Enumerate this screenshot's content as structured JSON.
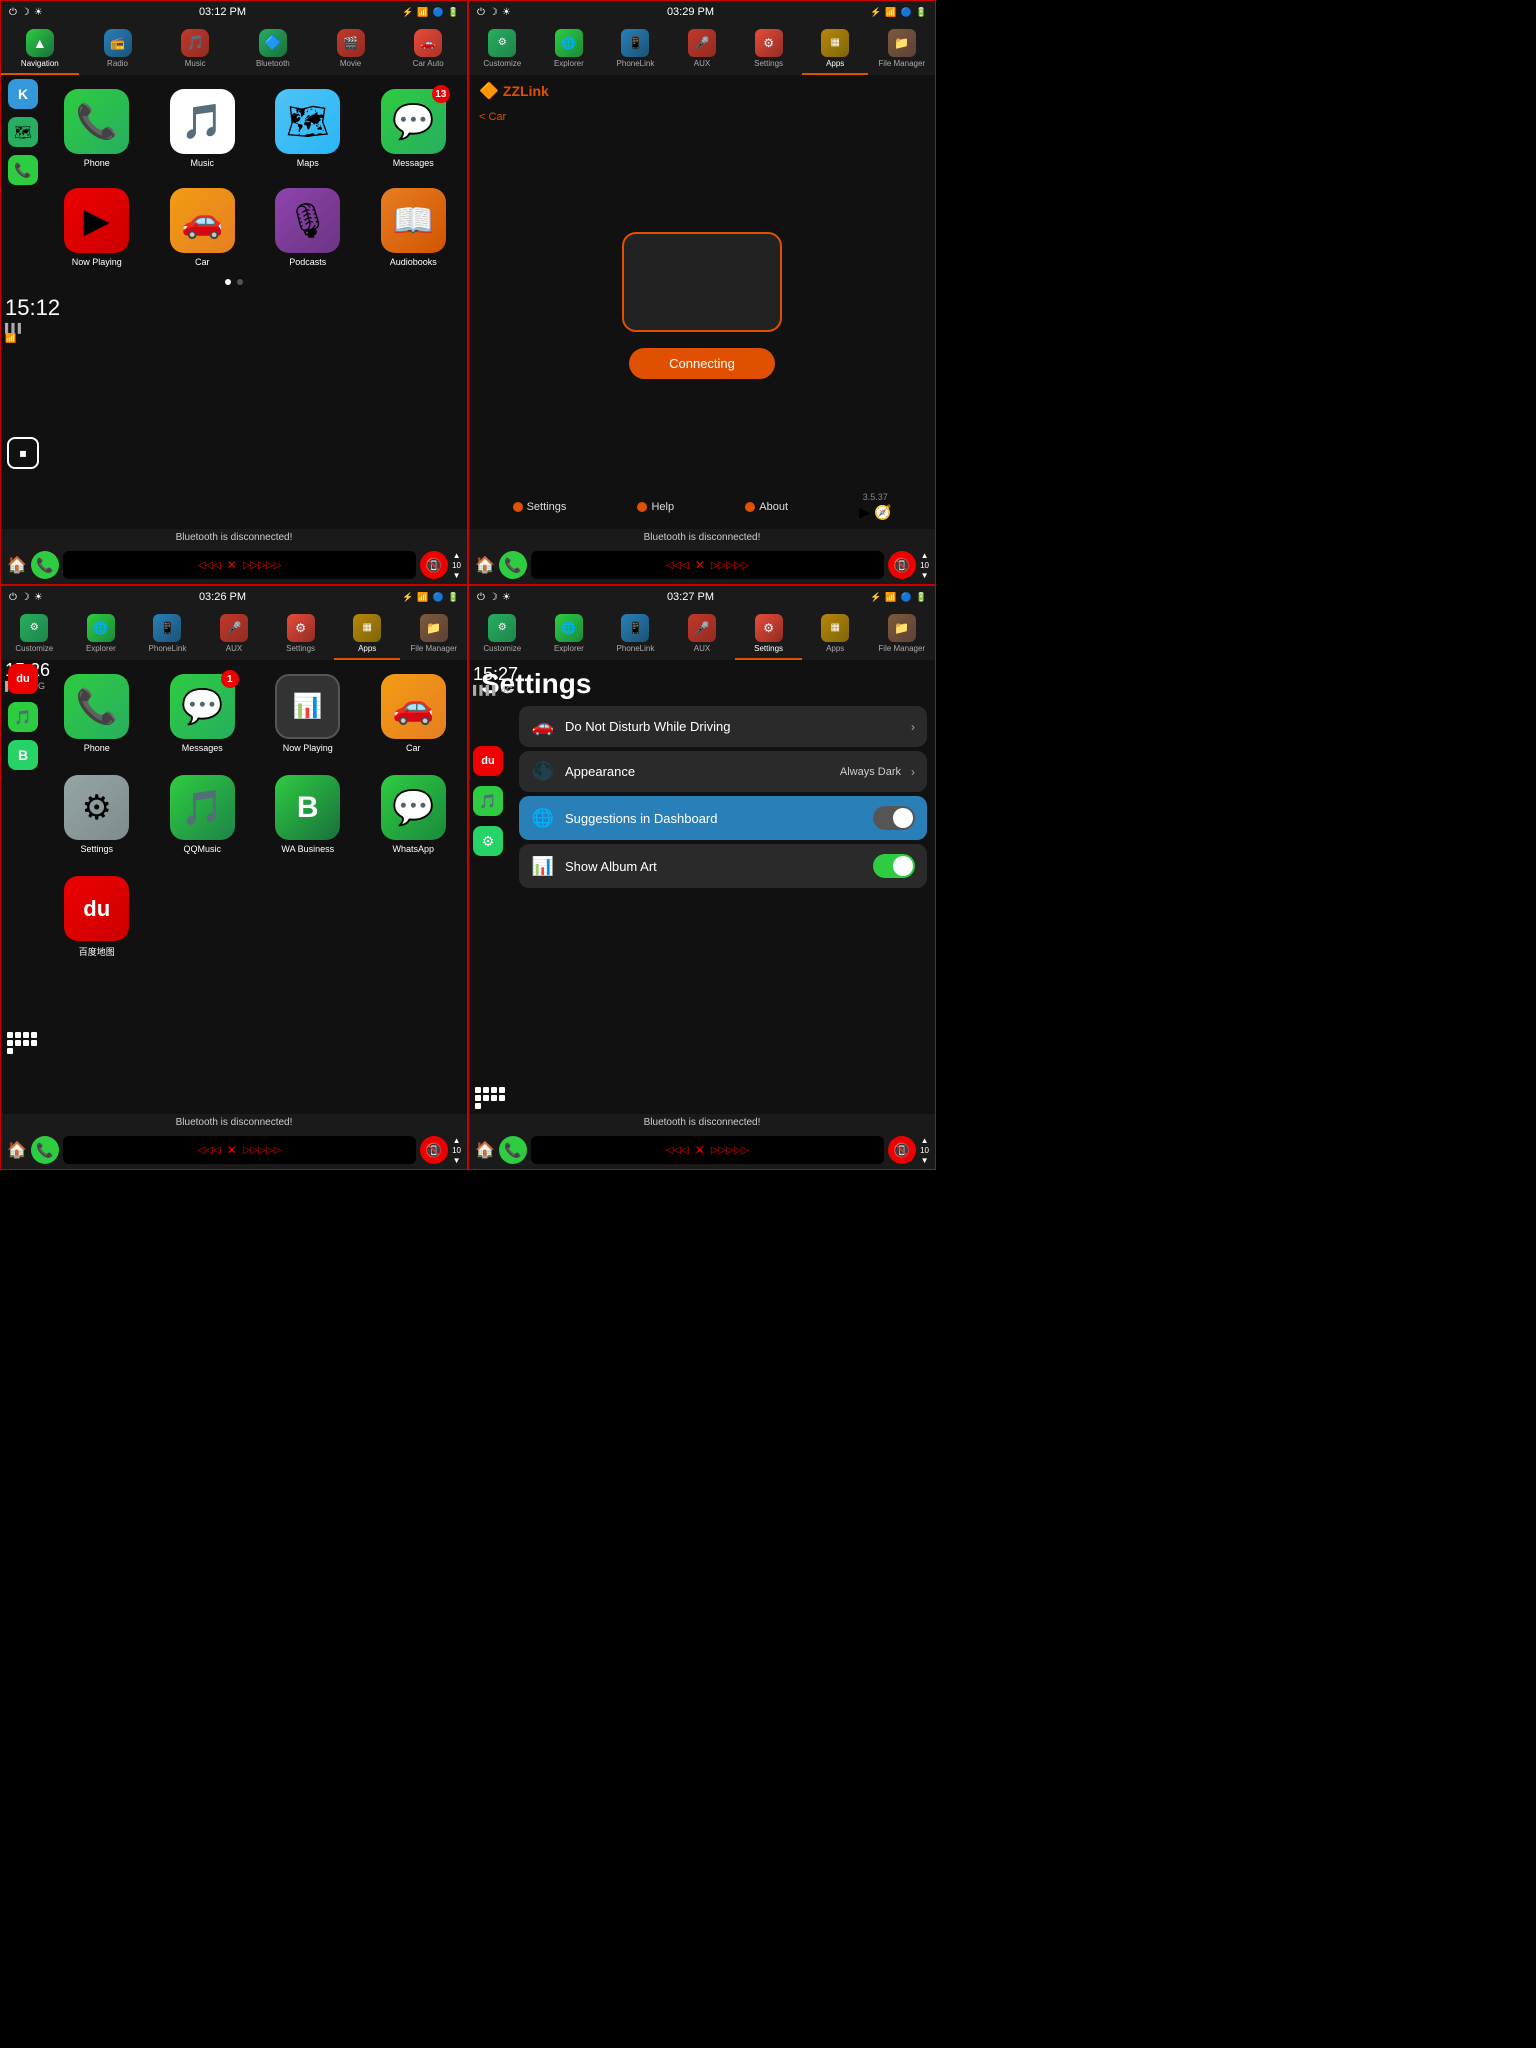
{
  "q1": {
    "time": "03:12 PM",
    "nav": [
      {
        "label": "Navigation",
        "icon": "▲"
      },
      {
        "label": "Radio",
        "icon": "📻"
      },
      {
        "label": "Music",
        "icon": "🎵"
      },
      {
        "label": "Bluetooth",
        "icon": "🔵"
      },
      {
        "label": "Movie",
        "icon": "🎬"
      },
      {
        "label": "Car Auto",
        "icon": "🚗"
      }
    ],
    "sidebar": [
      "K",
      "🗺",
      "📞"
    ],
    "apps_row1": [
      {
        "label": "Phone",
        "badge": null
      },
      {
        "label": "Music",
        "badge": null
      },
      {
        "label": "Maps",
        "badge": null
      },
      {
        "label": "Messages",
        "badge": "13"
      }
    ],
    "big_time": "15:12",
    "apps_row2": [
      {
        "label": "Now Playing",
        "badge": null
      },
      {
        "label": "Car",
        "badge": null
      },
      {
        "label": "Podcasts",
        "badge": null
      },
      {
        "label": "Audiobooks",
        "badge": null
      }
    ],
    "bt_status": "Bluetooth is disconnected!",
    "volume": "10"
  },
  "q2": {
    "time": "03:29 PM",
    "nav": [
      {
        "label": "Customize"
      },
      {
        "label": "Explorer"
      },
      {
        "label": "PhoneLink"
      },
      {
        "label": "AUX"
      },
      {
        "label": "Settings"
      },
      {
        "label": "Apps"
      },
      {
        "label": "File Manager"
      }
    ],
    "zlink_title": "ZLink",
    "back_label": "< Car",
    "connecting_label": "Connecting",
    "footer": [
      {
        "label": "Settings",
        "color": "#e05000"
      },
      {
        "label": "Help",
        "color": "#e05000"
      },
      {
        "label": "About",
        "color": "#e05000"
      }
    ],
    "version": "3.5.37",
    "bt_status": "Bluetooth is disconnected!",
    "volume": "10"
  },
  "q3": {
    "time": "03:26 PM",
    "big_time": "15:26",
    "signal": "4G",
    "nav": [
      {
        "label": "Customize"
      },
      {
        "label": "Explorer"
      },
      {
        "label": "PhoneLink"
      },
      {
        "label": "AUX"
      },
      {
        "label": "Settings"
      },
      {
        "label": "Apps"
      },
      {
        "label": "File Manager"
      }
    ],
    "apps_row1": [
      {
        "label": "Phone",
        "badge": null
      },
      {
        "label": "Messages",
        "badge": "1"
      },
      {
        "label": "Now Playing",
        "badge": null
      },
      {
        "label": "Car",
        "badge": null
      }
    ],
    "apps_row2": [
      {
        "label": "Settings",
        "badge": null
      },
      {
        "label": "QQMusic",
        "badge": null
      },
      {
        "label": "WA Business",
        "badge": null
      },
      {
        "label": "WhatsApp",
        "badge": null
      }
    ],
    "apps_row3": [
      {
        "label": "百度地图",
        "badge": null
      }
    ],
    "sidebar": [
      "du",
      "🎵",
      "B"
    ],
    "bt_status": "Bluetooth is disconnected!",
    "volume": "10"
  },
  "q4": {
    "time": "03:27 PM",
    "big_time": "15:27",
    "signal": "4G",
    "nav": [
      {
        "label": "Customize"
      },
      {
        "label": "Explorer"
      },
      {
        "label": "PhoneLink"
      },
      {
        "label": "AUX"
      },
      {
        "label": "Settings"
      },
      {
        "label": "Apps"
      },
      {
        "label": "File Manager"
      }
    ],
    "page_title": "Settings",
    "settings": [
      {
        "icon": "🚗",
        "label": "Do Not Disturb While Driving",
        "value": "",
        "type": "chevron",
        "color": "#4a90d9"
      },
      {
        "icon": "🌑",
        "label": "Appearance",
        "value": "Always Dark",
        "type": "chevron",
        "color": "#555"
      },
      {
        "icon": "🌐",
        "label": "Suggestions in Dashboard",
        "value": "",
        "type": "toggle_off",
        "color": "#c0392b",
        "highlight": true
      },
      {
        "icon": "📊",
        "label": "Show Album Art",
        "value": "",
        "type": "toggle_on",
        "color": "#e05000"
      }
    ],
    "bt_status": "Bluetooth is disconnected!",
    "volume": "10"
  }
}
